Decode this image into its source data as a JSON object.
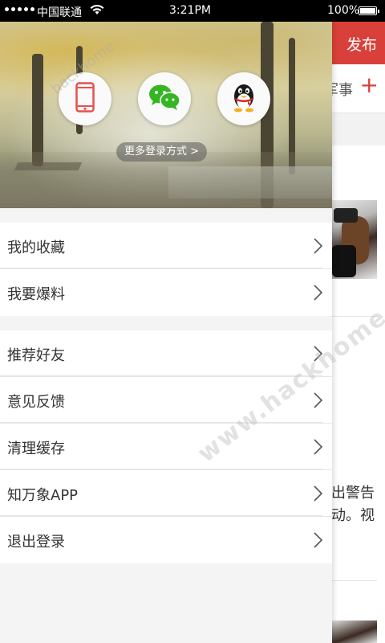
{
  "status_bar": {
    "carrier": "中国联通",
    "time": "3:21PM",
    "battery": "100%"
  },
  "background": {
    "publish_label": "发布",
    "tab_partial": "军事",
    "plus_label": "+",
    "article_partial_1": "出警告",
    "article_partial_2": "动。视"
  },
  "drawer": {
    "login_methods": [
      {
        "name": "phone",
        "icon": "phone-icon"
      },
      {
        "name": "wechat",
        "icon": "wechat-icon"
      },
      {
        "name": "qq",
        "icon": "qq-icon"
      }
    ],
    "more_login_label": "更多登录方式 >",
    "menu_group_1": [
      {
        "label": "我的收藏"
      },
      {
        "label": "我要爆料"
      }
    ],
    "menu_group_2": [
      {
        "label": "推荐好友"
      },
      {
        "label": "意见反馈"
      },
      {
        "label": "清理缓存"
      },
      {
        "label": "知万象APP"
      },
      {
        "label": "退出登录"
      }
    ]
  },
  "watermark": {
    "text": "www.hackhome.com",
    "small_text": "hackhome"
  },
  "colors": {
    "accent": "#d9403a",
    "phone_icon": "#e8504c",
    "wechat_icon": "#35b523"
  }
}
